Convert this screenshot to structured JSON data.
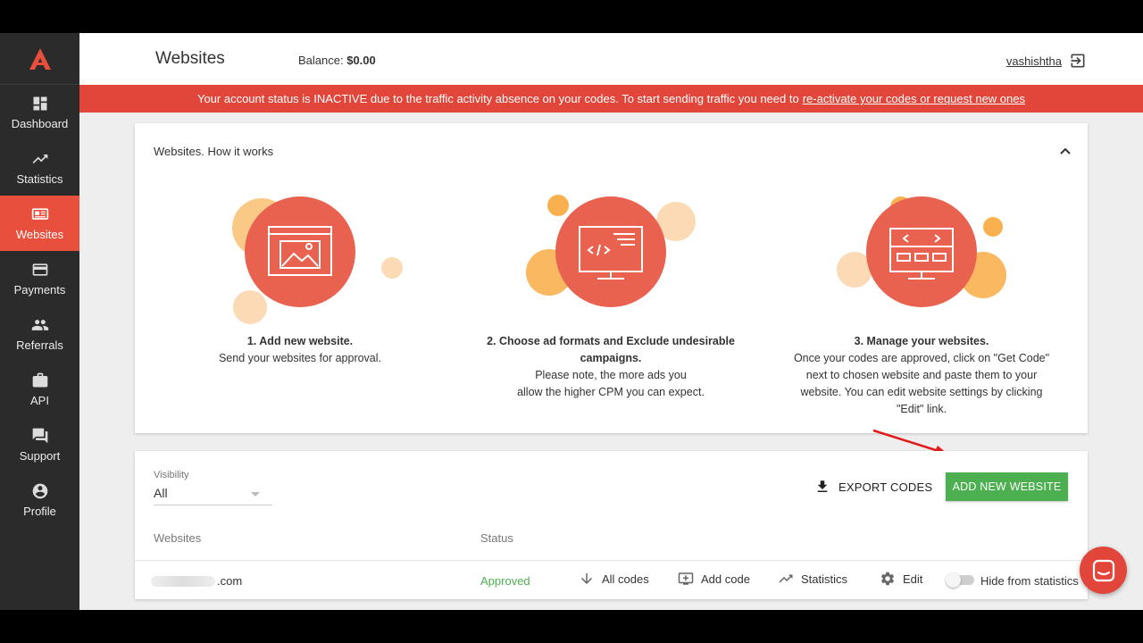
{
  "sidebar": {
    "logo_icon": "brand-a-logo",
    "items": [
      {
        "label": "Dashboard",
        "icon": "dashboard-icon"
      },
      {
        "label": "Statistics",
        "icon": "trending-up-icon"
      },
      {
        "label": "Websites",
        "icon": "websites-icon",
        "active": true
      },
      {
        "label": "Payments",
        "icon": "credit-card-icon"
      },
      {
        "label": "Referrals",
        "icon": "people-icon"
      },
      {
        "label": "API",
        "icon": "briefcase-icon"
      },
      {
        "label": "Support",
        "icon": "chat-bubbles-icon"
      },
      {
        "label": "Profile",
        "icon": "account-circle-icon"
      }
    ]
  },
  "header": {
    "title": "Websites",
    "balance_label": "Balance:",
    "balance_value": "$0.00",
    "username": "vashishtha"
  },
  "alert": {
    "text": "Your account status is INACTIVE due to the traffic activity absence on your codes. To start sending traffic you need to",
    "link": "re-activate your codes or request new ones"
  },
  "how_it_works": {
    "title": "Websites. How it works",
    "steps": [
      {
        "title": "1. Add new website.",
        "lines": [
          "Send your websites for approval."
        ]
      },
      {
        "title": "2. Choose ad formats and Exclude undesirable campaigns.",
        "lines": [
          "Please note, the more ads you",
          "allow the higher CPM you can expect."
        ]
      },
      {
        "title": "3. Manage your websites.",
        "lines": [
          "Once your codes are approved, click on \"Get Code\"",
          "next to chosen website and paste them to your",
          "website. You can edit website settings by clicking",
          "\"Edit\" link."
        ]
      }
    ]
  },
  "list": {
    "visibility_label": "Visibility",
    "visibility_value": "All",
    "export_label": "EXPORT CODES",
    "add_label": "ADD NEW WEBSITE",
    "col_websites": "Websites",
    "col_status": "Status",
    "row": {
      "site_suffix": ".com",
      "status": "Approved",
      "all_codes": "All codes",
      "add_code": "Add code",
      "statistics": "Statistics",
      "edit": "Edit",
      "hide": "Hide from statistics",
      "hide_enabled": false
    }
  },
  "colors": {
    "accent": "#e84f3d",
    "alert": "#e2463a",
    "success": "#4caf50",
    "sidebar": "#2b2b2b"
  }
}
